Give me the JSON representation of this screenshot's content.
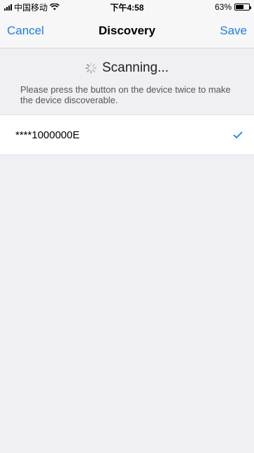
{
  "status_bar": {
    "carrier": "中国移动",
    "time": "下午4:58",
    "battery_percent": "63%",
    "battery_level": 0.63
  },
  "nav": {
    "cancel_label": "Cancel",
    "title": "Discovery",
    "save_label": "Save"
  },
  "scan": {
    "status": "Scanning...",
    "hint": "Please press the button on the device twice to make the device discoverable."
  },
  "devices": [
    {
      "name": "****1000000E",
      "selected": true
    }
  ],
  "colors": {
    "accent": "#1a7cf5",
    "background": "#efeff4"
  }
}
